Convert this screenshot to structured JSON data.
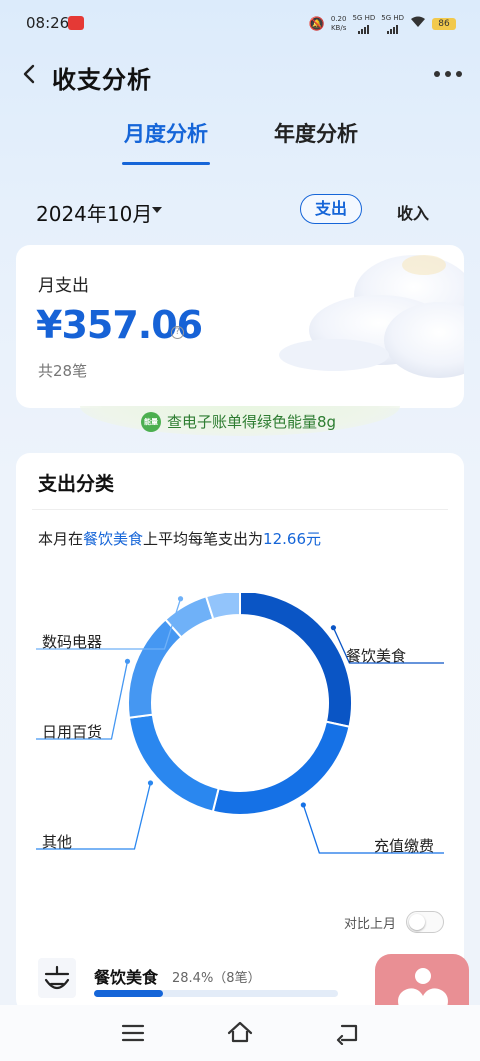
{
  "status_bar": {
    "time": "08:26",
    "net_speed": "0.20",
    "net_unit": "KB/s",
    "sim1": "5G HD",
    "sim2": "5G HD",
    "battery": "86"
  },
  "header": {
    "title": "收支分析"
  },
  "tabs": [
    {
      "label": "月度分析",
      "active": true
    },
    {
      "label": "年度分析",
      "active": false
    }
  ],
  "period": {
    "label": "2024年10月",
    "expense_label": "支出",
    "income_label": "收入"
  },
  "summary": {
    "label": "月支出",
    "amount": "¥357.06",
    "help_icon": "?",
    "count": "共28笔"
  },
  "energy_banner": {
    "badge": "能量",
    "text": "查电子账单得绿色能量8g"
  },
  "category": {
    "title": "支出分类",
    "avg_prefix": "本月在",
    "avg_category": "餐饮美食",
    "avg_middle": "上平均每笔支出为",
    "avg_value": "12.66元"
  },
  "chart_data": {
    "type": "pie",
    "categories": [
      "餐饮美食",
      "充值缴费",
      "其他",
      "日用百货",
      "数码电器"
    ],
    "values": [
      28.4,
      25.5,
      19.0,
      15.5,
      6.7
    ],
    "colors": [
      "#0a55c5",
      "#1571e6",
      "#2a87ef",
      "#4597f2",
      "#6fb1f8"
    ],
    "extra_segment": {
      "name": "",
      "value": 4.9,
      "color": "#92c4fb"
    },
    "title": "",
    "hole": true
  },
  "compare": {
    "label": "对比上月",
    "enabled": false
  },
  "top_category": {
    "name": "餐饮美食",
    "percent_text": "28.4%（8笔）",
    "fill_fraction": 0.284
  },
  "colors": {
    "accent": "#1565d8",
    "energy": "#2e7d32",
    "heart_bg": "#e98f94"
  }
}
